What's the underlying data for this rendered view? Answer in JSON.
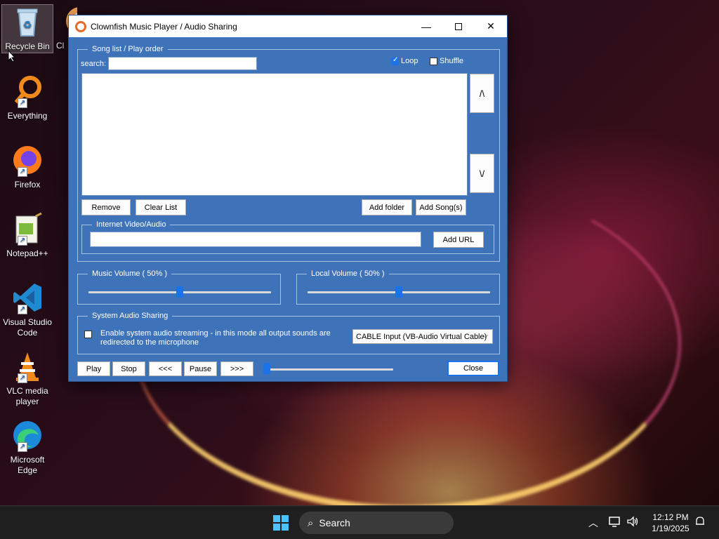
{
  "desktop": {
    "icons": [
      {
        "label": "Recycle Bin"
      },
      {
        "label": "Cl"
      },
      {
        "label": "Everything"
      },
      {
        "label": "Firefox"
      },
      {
        "label": "Notepad++"
      },
      {
        "label": "Visual Studio Code"
      },
      {
        "label": "VLC media player"
      },
      {
        "label": "Microsoft Edge"
      }
    ]
  },
  "window": {
    "title": "Clownfish Music Player / Audio Sharing",
    "song_list": {
      "group_label": "Song list / Play order",
      "search_label": "search:",
      "search_value": "",
      "loop_label": "Loop",
      "loop_checked": true,
      "shuffle_label": "Shuffle",
      "shuffle_checked": false,
      "up_label": "/\\",
      "down_label": "\\/",
      "remove_label": "Remove",
      "clear_label": "Clear List",
      "add_folder_label": "Add folder",
      "add_songs_label": "Add Song(s)"
    },
    "internet": {
      "group_label": "Internet Video/Audio",
      "url_value": "",
      "add_url_label": "Add URL"
    },
    "music_volume": {
      "label": "Music Volume ( 50% )",
      "value": 50
    },
    "local_volume": {
      "label": "Local Volume ( 50% )",
      "value": 50
    },
    "system_audio": {
      "group_label": "System Audio Sharing",
      "enable_label": "Enable system audio streaming - in this mode all output sounds are redirected to the microphone",
      "enabled": false,
      "device_selected": "CABLE Input (VB-Audio Virtual Cable)"
    },
    "transport": {
      "play": "Play",
      "stop": "Stop",
      "prev": "<<<",
      "pause": "Pause",
      "next": ">>>",
      "position": 0,
      "close": "Close"
    }
  },
  "taskbar": {
    "search_label": "Search",
    "time": "12:12 PM",
    "date": "1/19/2025"
  },
  "colors": {
    "window_bg": "#3f73b9",
    "accent": "#1a73e8"
  }
}
